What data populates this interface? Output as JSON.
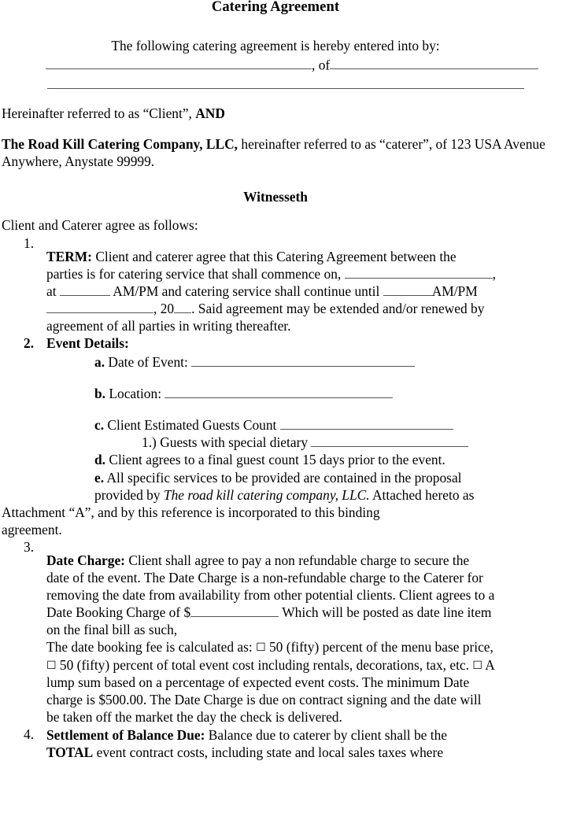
{
  "document": {
    "title": "Catering Agreement",
    "intro_line": "The following catering agreement is hereby entered into by:",
    "of_connector": ", of",
    "hereinafter_client_pre": "Hereinafter referred to as “Client”, ",
    "hereinafter_client_and": "AND",
    "caterer_name_bold": "The Road Kill Catering Company,  LLC,",
    "caterer_rest": " hereinafter referred to as “caterer”, of 123 USA Avenue Anywhere, Anystate 99999.",
    "witnesseth_heading": "Witnesseth",
    "agree_as_follows": "Client and Caterer agree as follows:"
  },
  "clauses": [
    {
      "number": "1.",
      "heading": "TERM:",
      "line1": "  Client and caterer agree that this Catering Agreement between the",
      "line2": "parties is for catering service that shall commence on, ",
      "line2_tail": ",",
      "line3_a": "at ",
      "line3_b": " AM/PM and catering service shall continue until ",
      "line3_c": "AM/PM",
      "line4_a": ", 20",
      "line4_b": ".  Said agreement may be extended and/or renewed by",
      "line5": "agreement of all parties in writing thereafter."
    },
    {
      "number": "2.",
      "heading": "Event Details:",
      "sub_items": [
        {
          "marker": "a.",
          "label": " Date of Event:"
        },
        {
          "marker": "b.",
          "label": " Location:"
        },
        {
          "marker": "c.",
          "label": " Client Estimated Guests Count"
        },
        {
          "marker": "1.)",
          "label": " Guests with special dietary"
        },
        {
          "marker": "d.",
          "label": " Client agrees to a final guest count 15 days prior to the event."
        },
        {
          "marker": "e.",
          "label": " All specific services to be provided are contained in the proposal"
        }
      ],
      "e_line2_pre": "provided by ",
      "e_line2_italic": "The road kill catering company, LLC.",
      "e_line2_post": " Attached hereto as",
      "e_line3": "Attachment “A”, and by this reference is incorporated to this binding",
      "e_line4": "agreement."
    },
    {
      "number": "3.",
      "heading": "Date Charge:",
      "line1": "  Client shall agree to pay a non refundable charge to secure the",
      "line2": "date of the event.  The Date Charge is a non-refundable charge to the Caterer for",
      "line3": "removing the date from availability from other potential clients.  Client agrees to a",
      "line4_a": "Date Booking Charge of $",
      "line4_b": " Which will be posted as date line item",
      "line5": "on the final bill as such,",
      "line6_a": "The date booking fee is calculated as: ",
      "checkbox_glyph": "☐",
      "line6_b": " 50 (fifty) percent of the menu base price,",
      "line7_b": " 50 (fifty) percent of total event cost including rentals, decorations, tax, etc. ",
      "line7_c": " A",
      "line8": "lump sum based on a percentage of expected event costs. The minimum Date",
      "line9": "charge is $500.00.  The Date Charge is due on contract signing and the date will",
      "line10": "be taken off the market the day the check is delivered."
    },
    {
      "number": "4.",
      "heading": "Settlement of Balance Due:",
      "line1": "  Balance due to caterer by client shall be the",
      "line2_bold": "TOTAL",
      "line2_rest": " event contract costs, including state and local sales taxes where"
    }
  ],
  "colors": {
    "page_background": "#ffffff",
    "text": "#000000",
    "rule_line": "#555555"
  }
}
